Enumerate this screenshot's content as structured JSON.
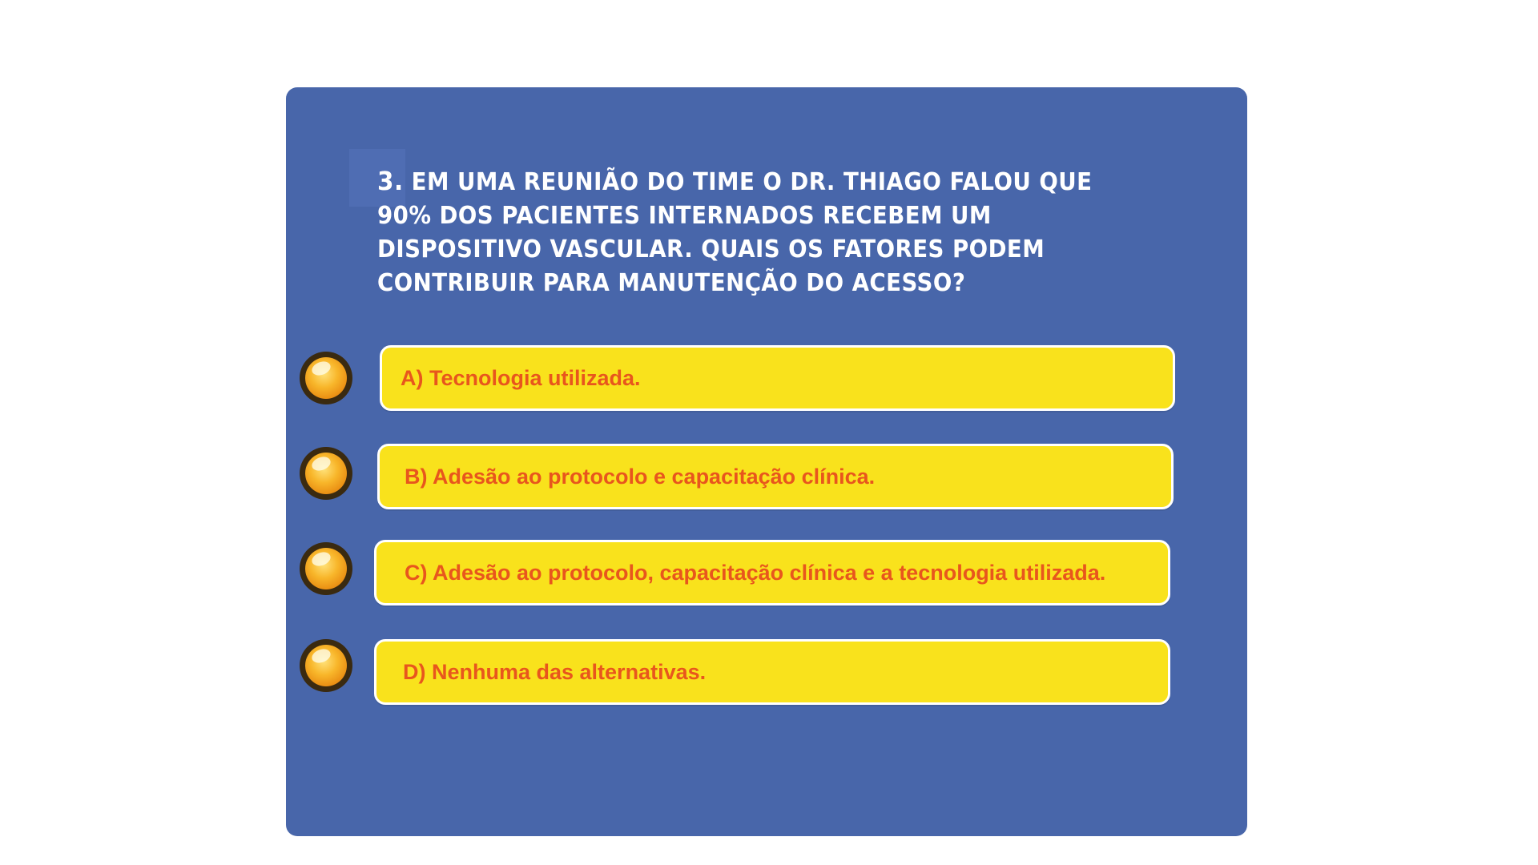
{
  "question": {
    "number": "3.",
    "text": "EM UMA REUNIÃO DO TIME O DR. THIAGO FALOU QUE 90% DOS PACIENTES INTERNADOS RECEBEM UM DISPOSITIVO VASCULAR. QUAIS OS FATORES PODEM CONTRIBUIR PARA MANUTENÇÃO DO ACESSO?"
  },
  "options": [
    {
      "label": "A) Tecnologia utilizada."
    },
    {
      "label": "B)  Adesão ao protocolo e capacitação clínica."
    },
    {
      "label": "C)  Adesão ao protocolo, capacitação clínica e a tecnologia utilizada."
    },
    {
      "label": "D)  Nenhuma das alternativas."
    }
  ],
  "colors": {
    "card_background": "#4866aa",
    "answer_background": "#f9e21c",
    "answer_text": "#e8561d",
    "question_text": "#ffffff",
    "bullet": "#f8b62a"
  },
  "icons": {
    "bullet": "orange-orb-icon"
  }
}
